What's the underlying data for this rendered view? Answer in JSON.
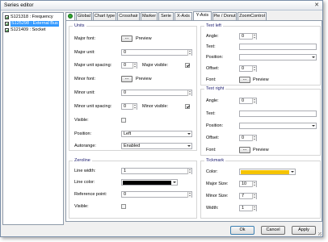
{
  "window": {
    "title": "Series editor"
  },
  "series": [
    {
      "label": "S121318 : Frequency",
      "checked": true,
      "selected": false
    },
    {
      "label": "S125298 : External Bus",
      "checked": true,
      "selected": true
    },
    {
      "label": "S121409 : Socket",
      "checked": true,
      "selected": false
    }
  ],
  "tabs": [
    {
      "label": "",
      "icon": "green-circle-icon"
    },
    {
      "label": "Global"
    },
    {
      "label": "Chart type"
    },
    {
      "label": "Crosshair"
    },
    {
      "label": "Marker"
    },
    {
      "label": "Serie"
    },
    {
      "label": "X-Axis"
    },
    {
      "label": "Y-Axis",
      "active": true
    },
    {
      "label": "Pie / Donut"
    },
    {
      "label": "ZoomControl"
    }
  ],
  "units": {
    "title": "Units",
    "major_font_label": "Major font:",
    "major_font_button": "...",
    "major_font_preview": "Preview",
    "major_unit_label": "Major unit:",
    "major_unit_value": "0",
    "major_unit_spacing_label": "Major unit spacing:",
    "major_unit_spacing_value": "0",
    "major_visible_label": "Major visible:",
    "major_visible_checked": true,
    "minor_font_label": "Minor font:",
    "minor_font_button": "...",
    "minor_font_preview": "Preview",
    "minor_unit_label": "Minor unit:",
    "minor_unit_value": "0",
    "minor_unit_spacing_label": "Minor unit spacing:",
    "minor_unit_spacing_value": "0",
    "minor_visible_label": "Minor visible:",
    "minor_visible_checked": true,
    "visible_label": "Visible:",
    "visible_checked": false,
    "position_label": "Position:",
    "position_value": "Left",
    "autorange_label": "Autorange:",
    "autorange_value": "Enabled"
  },
  "text_left": {
    "title": "Text left",
    "angle_label": "Angle:",
    "angle_value": "0",
    "text_label": "Text:",
    "text_value": "",
    "position_label": "Position:",
    "position_value": "",
    "offset_label": "Offset:",
    "offset_value": "0",
    "font_label": "Font:",
    "font_button": "...",
    "font_preview": "Preview"
  },
  "text_right": {
    "title": "Text right",
    "angle_label": "Angle:",
    "angle_value": "0",
    "text_label": "Text:",
    "text_value": "",
    "position_label": "Position:",
    "position_value": "",
    "offset_label": "Offset:",
    "offset_value": "0",
    "font_label": "Font:",
    "font_button": "...",
    "font_preview": "Preview"
  },
  "zeroline": {
    "title": "Zeroline",
    "line_width_label": "Line width:",
    "line_width_value": "1",
    "line_color_label": "Line color:",
    "line_color": "#000000",
    "reference_point_label": "Reference point:",
    "reference_point_value": "0",
    "visible_label": "Visible:",
    "visible_checked": false
  },
  "tickmark": {
    "title": "Tickmark",
    "color_label": "Color:",
    "color": "#f5c400",
    "major_size_label": "Major Size:",
    "major_size_value": "10",
    "minor_size_label": "Minor Size:",
    "minor_size_value": "7",
    "width_label": "Width:",
    "width_value": "1"
  },
  "buttons": {
    "ok": "Ok",
    "cancel": "Cancel",
    "apply": "Apply"
  }
}
